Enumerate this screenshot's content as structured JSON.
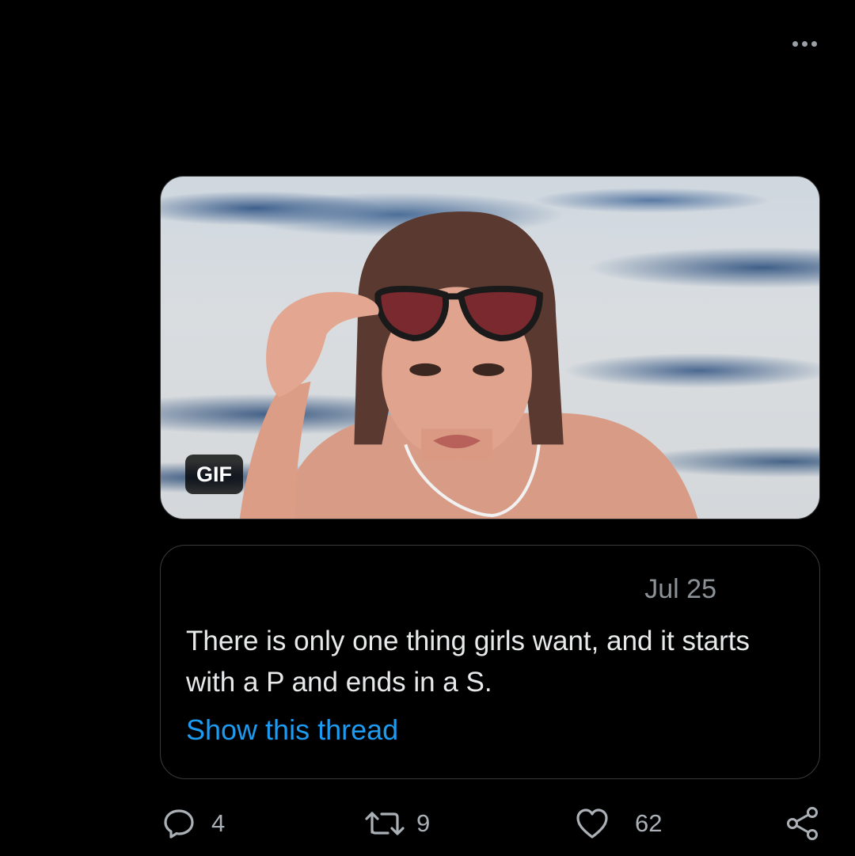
{
  "post": {
    "media": {
      "badge": "GIF",
      "water_color": "#cfd7df",
      "ripple_color": "#3f5f88"
    },
    "quote": {
      "date": "Jul 25",
      "text": "There is only one thing girls want, and it starts with a P and ends in a S.",
      "link": "Show this thread",
      "link_color": "#1d9bf0"
    },
    "actions": {
      "reply_count": "4",
      "retweet_count": "9",
      "like_count": "62",
      "icons": [
        "reply-icon",
        "retweet-icon",
        "like-icon",
        "share-icon"
      ]
    }
  }
}
